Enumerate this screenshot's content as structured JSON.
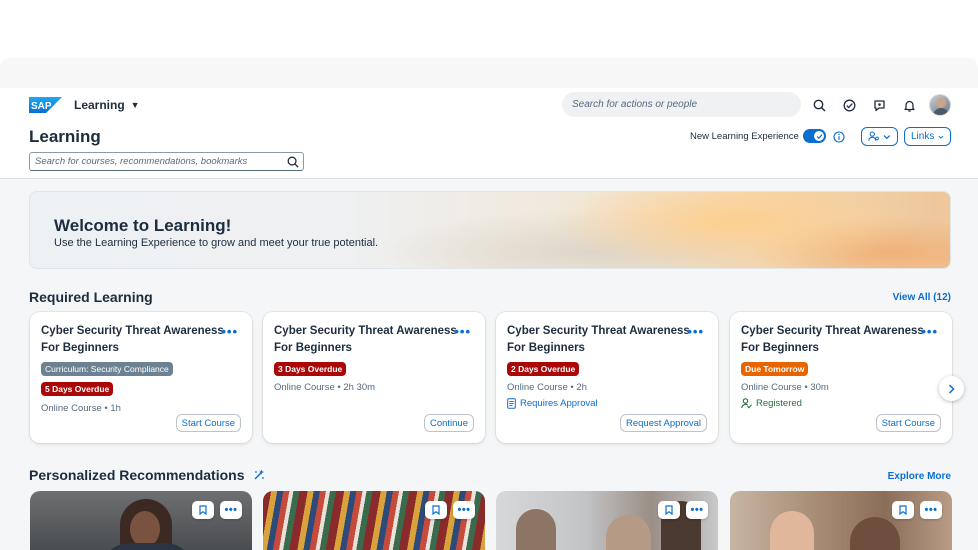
{
  "shell": {
    "app_title": "Learning",
    "search_placeholder": "Search for actions or people",
    "logo_text": "SAP"
  },
  "header": {
    "title": "Learning",
    "search_placeholder": "Search for courses, recommendations, bookmarks",
    "new_experience_label": "New Learning Experience",
    "new_experience_on": true,
    "links_label": "Links"
  },
  "banner": {
    "title": "Welcome to Learning!",
    "subtitle": "Use the Learning Experience to grow and meet your true potential."
  },
  "required": {
    "title": "Required Learning",
    "view_all": "View All (12)",
    "cards": [
      {
        "title": "Cyber Security Threat Awareness For Beginners",
        "tags": [
          "Curriculum: Security Compliance",
          "5 Days Overdue"
        ],
        "meta": "Online Course • 1h",
        "status": "",
        "button": "Start Course"
      },
      {
        "title": "Cyber Security Threat Awareness For Beginners",
        "tags": [
          "3 Days Overdue"
        ],
        "meta": "Online Course • 2h 30m",
        "status": "",
        "button": "Continue"
      },
      {
        "title": "Cyber Security Threat Awareness For Beginners",
        "tags": [
          "2 Days Overdue"
        ],
        "meta": "Online Course • 2h",
        "status": "Requires Approval",
        "button": "Request Approval"
      },
      {
        "title": "Cyber Security Threat Awareness For Beginners",
        "tags": [
          "Due Tomorrow"
        ],
        "meta": "Online Course • 30m",
        "status": "Registered",
        "button": "Start Course"
      }
    ]
  },
  "recommendations": {
    "title": "Personalized Recommendations",
    "explore": "Explore More"
  },
  "colors": {
    "accent": "#0a6ed1",
    "overdue": "#aa0808",
    "due": "#e76500",
    "positive": "#256f3a"
  }
}
